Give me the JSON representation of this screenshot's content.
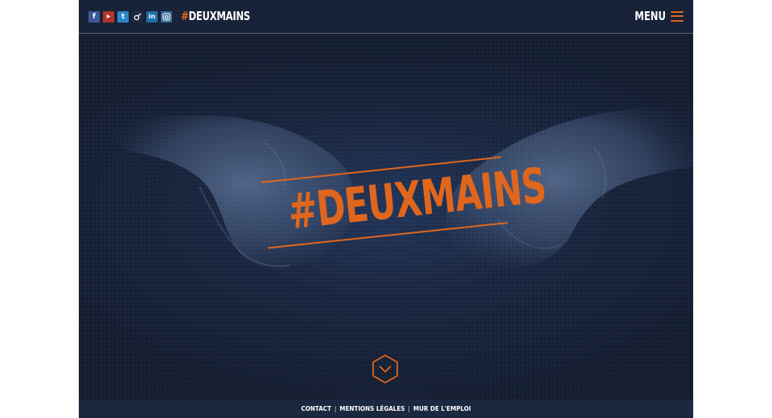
{
  "header": {
    "social_links": [
      {
        "name": "facebook",
        "glyph": "f",
        "color": "#3b5998"
      },
      {
        "name": "youtube",
        "glyph": "▶",
        "color": "#b0352b"
      },
      {
        "name": "twitter",
        "glyph": "t",
        "color": "#2a87c9"
      },
      {
        "name": "viadeo",
        "glyph": "v",
        "color": "#1d2a40"
      },
      {
        "name": "linkedin",
        "glyph": "in",
        "color": "#1f6fa8"
      },
      {
        "name": "instagram",
        "glyph": "◘",
        "color": "#3b6d98"
      }
    ],
    "brand_hash": "#",
    "brand_name": "DEUXMAINS",
    "menu_label": "MENU"
  },
  "hero": {
    "logo_text": "#DEUXMAINS",
    "scroll_icon": "chevron-down-icon"
  },
  "footer": {
    "links": [
      "CONTACT",
      "MENTIONS LÉGALES",
      "MUR DE L'EMPLOI"
    ],
    "separator": "|"
  },
  "colors": {
    "accent": "#e0661e",
    "background": "#141d30",
    "header": "#182238"
  }
}
